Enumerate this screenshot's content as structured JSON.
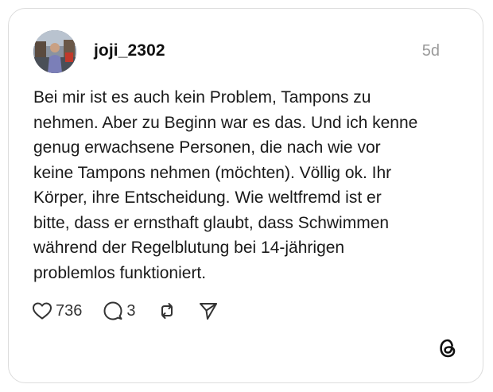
{
  "post": {
    "username": "joji_2302",
    "timestamp": "5d",
    "text": "Bei mir ist es auch kein Problem, Tampons zu\nnehmen. Aber zu Beginn war es das. Und ich kenne\ngenug erwachsene Personen, die nach wie vor\nkeine Tampons nehmen (möchten). Völlig ok. Ihr\nKörper, ihre Entscheidung. Wie weltfremd ist er\nbitte, dass er ernsthaft glaubt, dass Schwimmen\nwährend der Regelblutung bei 14-jährigen\nproblemlos funktioniert."
  },
  "actions": {
    "likes": "736",
    "replies": "3"
  },
  "icons": {
    "like": "heart-icon",
    "reply": "speech-bubble-icon",
    "repost": "repost-icon",
    "share": "send-icon",
    "brand": "threads-logo-icon"
  },
  "colors": {
    "text": "#1a1a1a",
    "muted": "#9a9a9a",
    "border": "#dcdcdc"
  }
}
